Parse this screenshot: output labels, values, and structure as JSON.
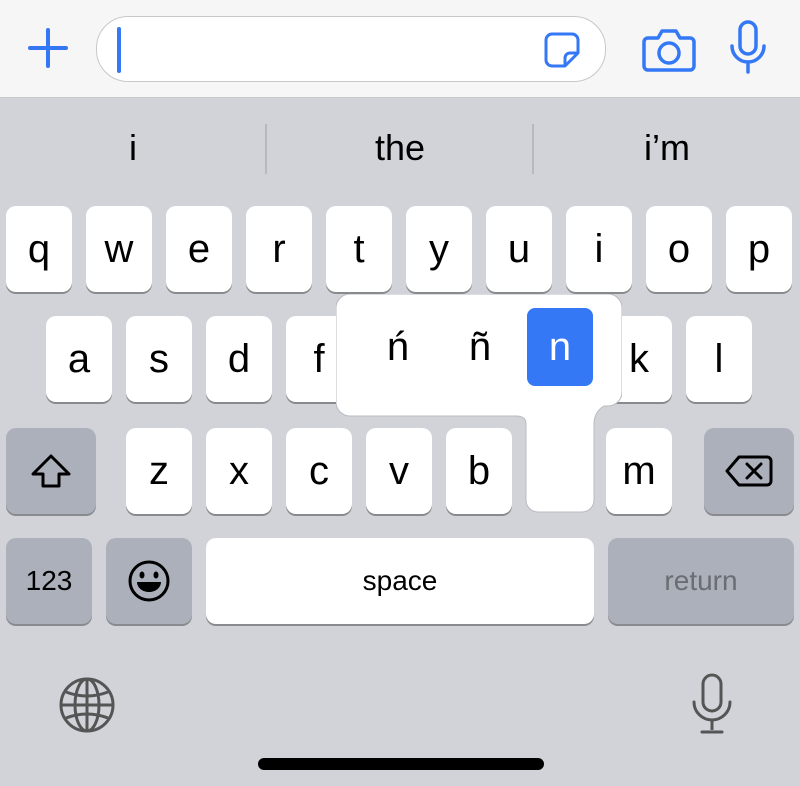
{
  "accent_color": "#3478f6",
  "top_bar": {
    "add_icon": "plus-icon",
    "message_input": {
      "value": "",
      "placeholder": ""
    },
    "sticker_icon": "sticker-icon",
    "camera_icon": "camera-icon",
    "mic_icon": "microphone-icon"
  },
  "suggestions": [
    "i",
    "the",
    "i’m"
  ],
  "keys": {
    "row1": [
      "q",
      "w",
      "e",
      "r",
      "t",
      "y",
      "u",
      "i",
      "o",
      "p"
    ],
    "row2": [
      "a",
      "s",
      "d",
      "f",
      "k",
      "l"
    ],
    "row3": [
      "z",
      "x",
      "c",
      "v",
      "b",
      "m"
    ],
    "row4": {
      "numbers": "123",
      "space": "space",
      "return": "return"
    }
  },
  "accent_popup": {
    "variants": [
      "ń",
      "ñ",
      "n"
    ],
    "selected": "n"
  },
  "bottom": {
    "globe_icon": "globe-icon",
    "mic_icon": "microphone-icon"
  }
}
